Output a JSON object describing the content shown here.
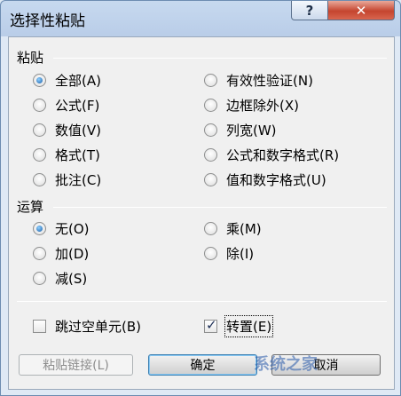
{
  "window": {
    "title": "选择性粘贴",
    "help_label": "?",
    "close_label": "✕"
  },
  "paste_group": {
    "label": "粘贴",
    "options_left": [
      "全部(A)",
      "公式(F)",
      "数值(V)",
      "格式(T)",
      "批注(C)"
    ],
    "options_right": [
      "有效性验证(N)",
      "边框除外(X)",
      "列宽(W)",
      "公式和数字格式(R)",
      "值和数字格式(U)"
    ],
    "selected": "全部(A)"
  },
  "operation_group": {
    "label": "运算",
    "options_left": [
      "无(O)",
      "加(D)",
      "减(S)"
    ],
    "options_right": [
      "乘(M)",
      "除(I)"
    ],
    "selected": "无(O)"
  },
  "checkboxes": {
    "skip_blanks": {
      "label": "跳过空单元(B)",
      "checked": false
    },
    "transpose": {
      "label": "转置(E)",
      "checked": true
    }
  },
  "buttons": {
    "paste_link": "粘贴链接(L)",
    "ok": "确定",
    "cancel": "取消"
  },
  "watermark": "系统之家"
}
